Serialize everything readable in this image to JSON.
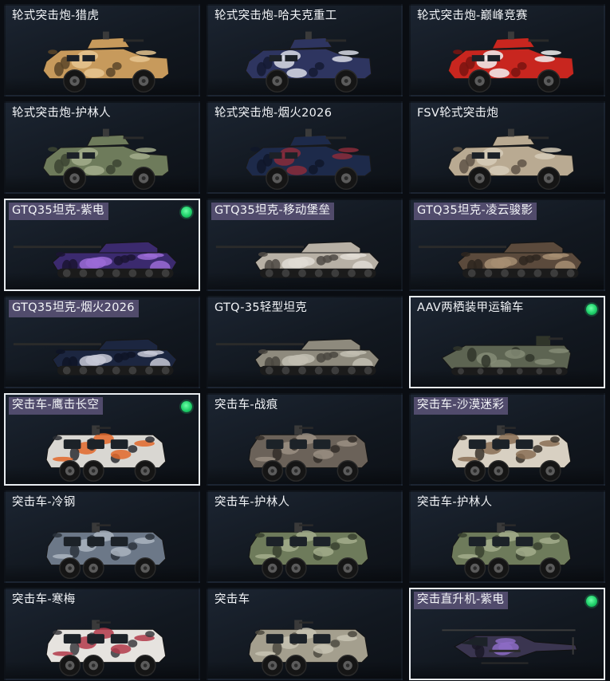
{
  "items": [
    {
      "label": "轮式突击炮-猎虎",
      "type": "wheeled",
      "paint": [
        "#c79a5c",
        "#e6c691",
        "#5a4528"
      ],
      "selected": false,
      "equipped": false,
      "hl": false
    },
    {
      "label": "轮式突击炮-哈夫克重工",
      "type": "wheeled",
      "paint": [
        "#2e3560",
        "#d9dce6",
        "#141a33"
      ],
      "selected": false,
      "equipped": false,
      "hl": false
    },
    {
      "label": "轮式突击炮-巅峰竞赛",
      "type": "wheeled",
      "paint": [
        "#c8261f",
        "#f2f2f2",
        "#7a1410"
      ],
      "selected": false,
      "equipped": false,
      "hl": false
    },
    {
      "label": "轮式突击炮-护林人",
      "type": "wheeled",
      "paint": [
        "#6e7b5b",
        "#a3ad8c",
        "#3c4432"
      ],
      "selected": false,
      "equipped": false,
      "hl": false
    },
    {
      "label": "轮式突击炮-烟火2026",
      "type": "wheeled",
      "paint": [
        "#1d2a4a",
        "#8a2c3a",
        "#0f1629"
      ],
      "selected": false,
      "equipped": false,
      "hl": false
    },
    {
      "label": "FSV轮式突击炮",
      "type": "wheeled",
      "paint": [
        "#b9aa92",
        "#d6ccb8",
        "#5e5446"
      ],
      "selected": false,
      "equipped": false,
      "hl": false
    },
    {
      "label": "GTQ35坦克-紫电",
      "type": "tank",
      "paint": [
        "#3b2a6e",
        "#9b6bd6",
        "#1b1433"
      ],
      "selected": true,
      "equipped": true,
      "hl": true
    },
    {
      "label": "GTQ35坦克-移动堡垒",
      "type": "tank",
      "paint": [
        "#b7b0a5",
        "#e0dcd4",
        "#4f4a44"
      ],
      "selected": false,
      "equipped": false,
      "hl": true
    },
    {
      "label": "GTQ35坦克-凌云骏影",
      "type": "tank",
      "paint": [
        "#5b4a3c",
        "#a78e72",
        "#2e261f"
      ],
      "selected": false,
      "equipped": false,
      "hl": true
    },
    {
      "label": "GTQ35坦克-烟火2026",
      "type": "tank",
      "paint": [
        "#1c2640",
        "#c7c9d6",
        "#0e1426"
      ],
      "selected": false,
      "equipped": false,
      "hl": true
    },
    {
      "label": "GTQ-35轻型坦克",
      "type": "tank",
      "paint": [
        "#8e8a7d",
        "#c2beb2",
        "#4a4740"
      ],
      "selected": false,
      "equipped": false,
      "hl": false
    },
    {
      "label": "AAV两栖装甲运输车",
      "type": "aav",
      "paint": [
        "#5d6452",
        "#848b76",
        "#30352a"
      ],
      "selected": true,
      "equipped": true,
      "hl": false
    },
    {
      "label": "突击车-鹰击长空",
      "type": "assault",
      "paint": [
        "#d9d7d2",
        "#e2682c",
        "#2a2d33"
      ],
      "selected": true,
      "equipped": true,
      "hl": true
    },
    {
      "label": "突击车-战痕",
      "type": "assault",
      "paint": [
        "#6b6259",
        "#9a8f82",
        "#332e29"
      ],
      "selected": false,
      "equipped": false,
      "hl": false
    },
    {
      "label": "突击车-沙漠迷彩",
      "type": "assault",
      "paint": [
        "#d8d0c2",
        "#8a6f55",
        "#3a322a"
      ],
      "selected": false,
      "equipped": false,
      "hl": true
    },
    {
      "label": "突击车-冷钢",
      "type": "assault",
      "paint": [
        "#6c7888",
        "#aab4c0",
        "#2c333c"
      ],
      "selected": false,
      "equipped": false,
      "hl": false
    },
    {
      "label": "突击车-护林人",
      "type": "assault",
      "paint": [
        "#6e7b5b",
        "#a3ad8c",
        "#3a4230"
      ],
      "selected": false,
      "equipped": false,
      "hl": false
    },
    {
      "label": "突击车-护林人",
      "type": "assault",
      "paint": [
        "#6e7b5b",
        "#a3ad8c",
        "#3a4230"
      ],
      "selected": false,
      "equipped": false,
      "hl": false
    },
    {
      "label": "突击车-寒梅",
      "type": "assault",
      "paint": [
        "#e6e3df",
        "#b23a4a",
        "#3b3b40"
      ],
      "selected": false,
      "equipped": false,
      "hl": false
    },
    {
      "label": "突击车",
      "type": "assault",
      "paint": [
        "#a49f8e",
        "#c8c3b3",
        "#4d4a41"
      ],
      "selected": false,
      "equipped": false,
      "hl": false
    },
    {
      "label": "突击直升机-紫电",
      "type": "heli",
      "paint": [
        "#3a3550",
        "#8c6bc4",
        "#1a1826"
      ],
      "selected": true,
      "equipped": true,
      "hl": true
    }
  ]
}
